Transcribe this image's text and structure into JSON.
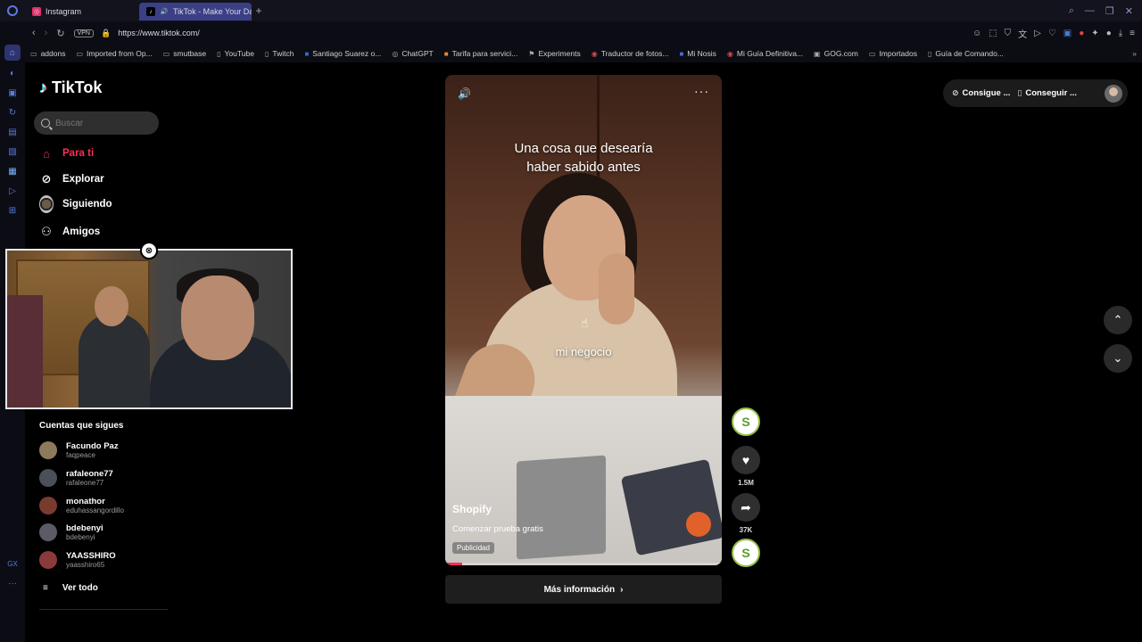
{
  "browser": {
    "tabs": [
      {
        "label": "Instagram",
        "icon": "instagram-icon",
        "color": "#e1306c"
      },
      {
        "label": "TikTok - Make Your Da",
        "icon": "tiktok-icon",
        "color": "#000000"
      }
    ],
    "url": "https://www.tiktok.com/",
    "vpn_label": "VPN",
    "bookmarks": [
      {
        "label": "addons",
        "icon": "folder-icon"
      },
      {
        "label": "Imported from Op...",
        "icon": "folder-icon"
      },
      {
        "label": "smutbase",
        "icon": "folder-icon"
      },
      {
        "label": "YouTube",
        "icon": "page-icon"
      },
      {
        "label": "Twitch",
        "icon": "page-icon"
      },
      {
        "label": "Santiago Suarez o...",
        "icon": "behance-icon"
      },
      {
        "label": "ChatGPT",
        "icon": "chatgpt-icon"
      },
      {
        "label": "Tarifa para servici...",
        "icon": "tarifa-icon"
      },
      {
        "label": "Experiments",
        "icon": "flag-icon"
      },
      {
        "label": "Traductor de fotos...",
        "icon": "translate-icon"
      },
      {
        "label": "Mi Nosis",
        "icon": "nosis-icon"
      },
      {
        "label": "Mi Guía Definitiva...",
        "icon": "guide-icon"
      },
      {
        "label": "GOG.com",
        "icon": "gog-icon"
      },
      {
        "label": "Importados",
        "icon": "folder-icon"
      },
      {
        "label": "Guía de Comando...",
        "icon": "page-icon"
      }
    ]
  },
  "tiktok": {
    "logo": "TikTok",
    "search_placeholder": "Buscar",
    "menu": [
      {
        "label": "Para ti",
        "icon": "home-icon",
        "active": true
      },
      {
        "label": "Explorar",
        "icon": "compass-icon",
        "active": false
      },
      {
        "label": "Siguiendo",
        "icon": "avatar-icon",
        "active": false
      },
      {
        "label": "Amigos",
        "icon": "friends-icon",
        "active": false
      }
    ],
    "following_title": "Cuentas que sigues",
    "accounts": [
      {
        "name": "Facundo Paz",
        "handle": "faqpeace",
        "color": "#8c7a5a"
      },
      {
        "name": "rafaleone77",
        "handle": "rafaleone77",
        "color": "#4a4f5a"
      },
      {
        "name": "monathor",
        "handle": "eduhassangordillo",
        "color": "#7a3b2e"
      },
      {
        "name": "bdebenyi",
        "handle": "bdebenyi",
        "color": "#5b5b66"
      },
      {
        "name": "YAASSHIRO",
        "handle": "yaasshiro65",
        "color": "#8a3a3a"
      }
    ],
    "see_all": "Ver todo"
  },
  "video": {
    "caption_top_line1": "Una cosa que desearía",
    "caption_top_line2": "haber sabido antes",
    "caption_mid": "mi negocio",
    "ad_brand": "Shopify",
    "ad_cta": "Comenzar prueba gratis",
    "ad_tag": "Publicidad",
    "progress": 0.06,
    "more_info": "Más información"
  },
  "actions": {
    "likes": "1.5M",
    "shares": "37K"
  },
  "top_right": {
    "pill1": "Consigue ...",
    "pill2": "Conseguir ..."
  },
  "colors": {
    "accent": "#fe2c55",
    "browser_tab_active": "#3b3f86",
    "shopify_green": "#95bf47"
  }
}
